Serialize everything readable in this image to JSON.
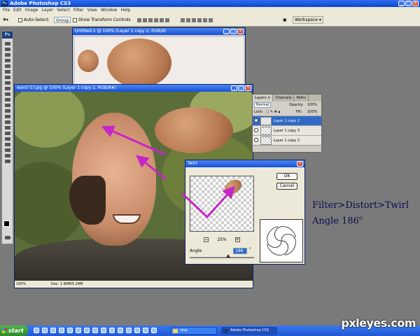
{
  "app": {
    "title": "Adobe Photoshop CS3",
    "icon": "ps-icon"
  },
  "menubar": [
    "File",
    "Edit",
    "Image",
    "Layer",
    "Select",
    "Filter",
    "View",
    "Window",
    "Help"
  ],
  "options_bar": {
    "auto_select_label": "Auto-Select:",
    "auto_select_value": "Group",
    "transform_label": "Show Transform Controls",
    "workspace_label": "Workspace ▾"
  },
  "toolbox": {
    "logo": "Ps"
  },
  "documents": [
    {
      "title": "Untitled-1 @ 100% (Layer 1 copy 2, RGB/8)"
    },
    {
      "title": "ward (1).jpg @ 100% (Layer 1 copy 2, RGB/8#)",
      "zoom": "100%",
      "doc_size": "Doc: 1.90M/5.24M"
    }
  ],
  "layers_panel": {
    "tabs": [
      "Layers ×",
      "Channels",
      "Paths"
    ],
    "blend_mode": "Normal",
    "opacity_label": "Opacity:",
    "opacity_value": "100%",
    "lock_label": "Lock:",
    "fill_label": "Fill:",
    "fill_value": "100%",
    "layers": [
      {
        "name": "Layer 1 copy 2",
        "selected": true
      },
      {
        "name": "Layer 1 copy 3",
        "selected": false
      },
      {
        "name": "Layer 1 copy 2",
        "selected": false
      }
    ]
  },
  "twirl_dialog": {
    "title": "Twirl",
    "ok_label": "OK",
    "cancel_label": "Cancel",
    "zoom_minus": "−",
    "zoom_plus": "+",
    "zoom_value": "25%",
    "angle_label": "Angle",
    "angle_value": "186",
    "angle_unit": "°"
  },
  "annotation": {
    "line1": "Filter>Distort>Twirl",
    "line2_prefix": "Angle 186",
    "line2_sup": "o"
  },
  "taskbar": {
    "start_label": "start",
    "buttons": [
      {
        "label": "step",
        "active": false
      },
      {
        "label": "Adobe Photoshop CS3",
        "active": true
      }
    ]
  },
  "watermark": "pxleyes.com",
  "colors": {
    "arrow": "#c626c6",
    "selection": "#316ac5",
    "xp_blue": "#1f57d4"
  }
}
